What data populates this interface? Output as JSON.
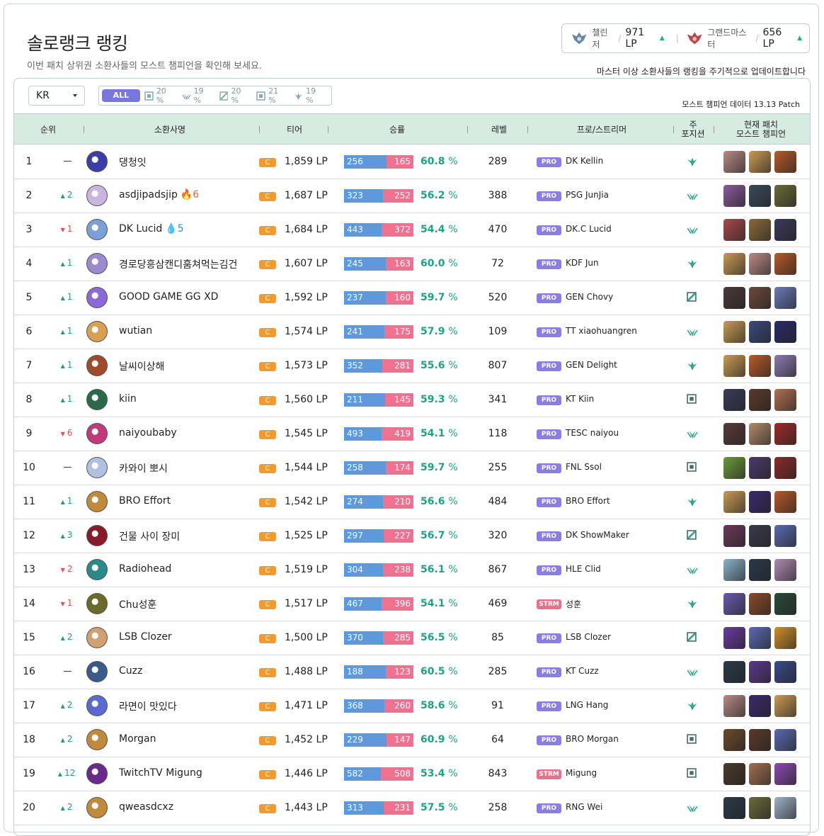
{
  "header": {
    "title": "솔로랭크 랭킹",
    "subtitle": "이번 패치 상위권 소환사들의 모스트 챔피언을 확인해 보세요.",
    "update_note": "마스터 이상 소환사들의 랭킹을 주기적으로 업데이트합니다"
  },
  "cutoffs": [
    {
      "tier": "챌린저",
      "lp": "971 LP",
      "emblem": "challenger-emblem-icon",
      "color": "#6a86a0"
    },
    {
      "tier": "그랜드마스터",
      "lp": "656 LP",
      "emblem": "grandmaster-emblem-icon",
      "color": "#b84a4a"
    }
  ],
  "filters": {
    "region": "KR",
    "all_label": "ALL",
    "positions": [
      {
        "icon": "top-icon",
        "pct": "20 %"
      },
      {
        "icon": "jungle-icon",
        "pct": "19 %"
      },
      {
        "icon": "mid-icon",
        "pct": "20 %"
      },
      {
        "icon": "bottom-icon",
        "pct": "21 %"
      },
      {
        "icon": "support-icon",
        "pct": "19 %"
      }
    ],
    "patch_note": "모스트 챔피언 데이터 13.13 Patch"
  },
  "columns": {
    "rank": "순위",
    "summoner": "소환사명",
    "tier": "티어",
    "winloss": "승률",
    "level": "레벨",
    "pro": "프로/스트리머",
    "position": "주\n포지션",
    "champions": "현재 패치\n모스트 챔피언"
  },
  "tier_letter": "C",
  "rows": [
    {
      "rank": "1",
      "change": "—",
      "dir": "none",
      "name": "댕청잇",
      "streak": "",
      "streak_type": "",
      "lp": "1,859 LP",
      "wins": "256",
      "losses": "165",
      "winrate": "60.8",
      "level": "289",
      "badge": "PRO",
      "pro": "DK Kellin",
      "pos": "support",
      "avatar": "#3b3ea8",
      "champs": [
        "#b88a86",
        "#c99a55",
        "#b65a2a"
      ]
    },
    {
      "rank": "2",
      "change": "2",
      "dir": "up",
      "name": "asdjipadsjip",
      "streak": "6",
      "streak_type": "fire",
      "lp": "1,687 LP",
      "wins": "323",
      "losses": "252",
      "winrate": "56.2",
      "level": "388",
      "badge": "PRO",
      "pro": "PSG JunJia",
      "pos": "jungle",
      "avatar": "#c9b6e0",
      "champs": [
        "#8a5a9a",
        "#3a4a5a",
        "#6a6a3a"
      ]
    },
    {
      "rank": "3",
      "change": "1",
      "dir": "down",
      "name": "DK Lucid",
      "streak": "5",
      "streak_type": "water",
      "lp": "1,684 LP",
      "wins": "443",
      "losses": "372",
      "winrate": "54.4",
      "level": "470",
      "badge": "PRO",
      "pro": "DK.C Lucid",
      "pos": "jungle",
      "avatar": "#7aa0d8",
      "champs": [
        "#a84a4a",
        "#8a6a3a",
        "#3a3a5a"
      ]
    },
    {
      "rank": "4",
      "change": "1",
      "dir": "up",
      "name": "경로당흥삼캔디훔쳐먹는김건",
      "streak": "",
      "streak_type": "",
      "lp": "1,607 LP",
      "wins": "245",
      "losses": "163",
      "winrate": "60.0",
      "level": "72",
      "badge": "PRO",
      "pro": "KDF Jun",
      "pos": "support",
      "avatar": "#9a8ad0",
      "champs": [
        "#c99a55",
        "#b88a86",
        "#b65a2a"
      ]
    },
    {
      "rank": "5",
      "change": "1",
      "dir": "up",
      "name": "GOOD GAME GG XD",
      "streak": "",
      "streak_type": "",
      "lp": "1,592 LP",
      "wins": "237",
      "losses": "160",
      "winrate": "59.7",
      "level": "520",
      "badge": "PRO",
      "pro": "GEN Chovy",
      "pos": "mid",
      "avatar": "#8a6ad8",
      "champs": [
        "#4a3a3a",
        "#6a4a3a",
        "#6a7ab8"
      ]
    },
    {
      "rank": "6",
      "change": "1",
      "dir": "up",
      "name": "wutian",
      "streak": "",
      "streak_type": "",
      "lp": "1,574 LP",
      "wins": "241",
      "losses": "175",
      "winrate": "57.9",
      "level": "109",
      "badge": "PRO",
      "pro": "TT xiaohuangren",
      "pos": "jungle",
      "avatar": "#d8a050",
      "champs": [
        "#c99a55",
        "#3a4a7a",
        "#2a2a6a"
      ]
    },
    {
      "rank": "7",
      "change": "1",
      "dir": "up",
      "name": "날씨이상해",
      "streak": "",
      "streak_type": "",
      "lp": "1,573 LP",
      "wins": "352",
      "losses": "281",
      "winrate": "55.6",
      "level": "807",
      "badge": "PRO",
      "pro": "GEN Delight",
      "pos": "support",
      "avatar": "#a04a2a",
      "champs": [
        "#c99a55",
        "#b65a2a",
        "#8a7ab0"
      ]
    },
    {
      "rank": "8",
      "change": "1",
      "dir": "up",
      "name": "kiin",
      "streak": "",
      "streak_type": "",
      "lp": "1,560 LP",
      "wins": "211",
      "losses": "145",
      "winrate": "59.3",
      "level": "341",
      "badge": "PRO",
      "pro": "KT Kiin",
      "pos": "top",
      "avatar": "#2a6a4a",
      "champs": [
        "#3a3a5a",
        "#5a3a2a",
        "#b07050"
      ]
    },
    {
      "rank": "9",
      "change": "6",
      "dir": "down",
      "name": "naiyoubaby",
      "streak": "",
      "streak_type": "",
      "lp": "1,545 LP",
      "wins": "493",
      "losses": "419",
      "winrate": "54.1",
      "level": "118",
      "badge": "PRO",
      "pro": "TESC naiyou",
      "pos": "jungle",
      "avatar": "#c03a7a",
      "champs": [
        "#5a3a3a",
        "#b08a6a",
        "#a02a2a"
      ]
    },
    {
      "rank": "10",
      "change": "—",
      "dir": "none",
      "name": "카와이 뽀시",
      "streak": "",
      "streak_type": "",
      "lp": "1,544 LP",
      "wins": "258",
      "losses": "174",
      "winrate": "59.7",
      "level": "255",
      "badge": "PRO",
      "pro": "FNL Ssol",
      "pos": "top",
      "avatar": "#b0c0e0",
      "champs": [
        "#6a9a3a",
        "#4a3a6a",
        "#8a2a2a"
      ]
    },
    {
      "rank": "11",
      "change": "1",
      "dir": "up",
      "name": "BRO Effort",
      "streak": "",
      "streak_type": "",
      "lp": "1,542 LP",
      "wins": "274",
      "losses": "210",
      "winrate": "56.6",
      "level": "484",
      "badge": "PRO",
      "pro": "BRO Effort",
      "pos": "support",
      "avatar": "#c08a3a",
      "champs": [
        "#c99a55",
        "#3a2a6a",
        "#b65a2a"
      ]
    },
    {
      "rank": "12",
      "change": "3",
      "dir": "up",
      "name": "건물 사이 장미",
      "streak": "",
      "streak_type": "",
      "lp": "1,525 LP",
      "wins": "297",
      "losses": "227",
      "winrate": "56.7",
      "level": "320",
      "badge": "PRO",
      "pro": "DK ShowMaker",
      "pos": "mid",
      "avatar": "#8a1a2a",
      "champs": [
        "#6a3a5a",
        "#3a3a4a",
        "#5a6ab0"
      ]
    },
    {
      "rank": "13",
      "change": "2",
      "dir": "down",
      "name": "Radiohead",
      "streak": "",
      "streak_type": "",
      "lp": "1,519 LP",
      "wins": "304",
      "losses": "238",
      "winrate": "56.1",
      "level": "867",
      "badge": "PRO",
      "pro": "HLE Clid",
      "pos": "jungle",
      "avatar": "#2a8a8a",
      "champs": [
        "#8ab0c8",
        "#2a3a4a",
        "#b08ab0"
      ]
    },
    {
      "rank": "14",
      "change": "1",
      "dir": "down",
      "name": "Chu성훈",
      "streak": "",
      "streak_type": "",
      "lp": "1,517 LP",
      "wins": "467",
      "losses": "396",
      "winrate": "54.1",
      "level": "469",
      "badge": "STRM",
      "pro": "성훈",
      "pos": "support",
      "avatar": "#6a6a2a",
      "champs": [
        "#6a5ab0",
        "#8a4a2a",
        "#2a4a3a"
      ]
    },
    {
      "rank": "15",
      "change": "2",
      "dir": "up",
      "name": "LSB Clozer",
      "streak": "",
      "streak_type": "",
      "lp": "1,500 LP",
      "wins": "370",
      "losses": "285",
      "winrate": "56.5",
      "level": "85",
      "badge": "PRO",
      "pro": "LSB Clozer",
      "pos": "mid",
      "avatar": "#d0a070",
      "champs": [
        "#6a3aa0",
        "#5a6ab0",
        "#d0902a"
      ]
    },
    {
      "rank": "16",
      "change": "—",
      "dir": "none",
      "name": "Cuzz",
      "streak": "",
      "streak_type": "",
      "lp": "1,488 LP",
      "wins": "188",
      "losses": "123",
      "winrate": "60.5",
      "level": "285",
      "badge": "PRO",
      "pro": "KT Cuzz",
      "pos": "jungle",
      "avatar": "#3a5a8a",
      "champs": [
        "#2a3a4a",
        "#5a3a8a",
        "#3a4a8a"
      ]
    },
    {
      "rank": "17",
      "change": "2",
      "dir": "up",
      "name": "라면이 맛있다",
      "streak": "",
      "streak_type": "",
      "lp": "1,471 LP",
      "wins": "368",
      "losses": "260",
      "winrate": "58.6",
      "level": "91",
      "badge": "PRO",
      "pro": "LNG Hang",
      "pos": "support",
      "avatar": "#5a6ad0",
      "champs": [
        "#b88a86",
        "#3a2a6a",
        "#c99a55"
      ]
    },
    {
      "rank": "18",
      "change": "2",
      "dir": "up",
      "name": "Morgan",
      "streak": "",
      "streak_type": "",
      "lp": "1,452 LP",
      "wins": "229",
      "losses": "147",
      "winrate": "60.9",
      "level": "64",
      "badge": "PRO",
      "pro": "BRO Morgan",
      "pos": "top",
      "avatar": "#c08a3a",
      "champs": [
        "#6a4a2a",
        "#5a3a2a",
        "#5a6ab0"
      ]
    },
    {
      "rank": "19",
      "change": "12",
      "dir": "up",
      "name": "TwitchTV Migung",
      "streak": "",
      "streak_type": "",
      "lp": "1,446 LP",
      "wins": "582",
      "losses": "508",
      "winrate": "53.4",
      "level": "843",
      "badge": "STRM",
      "pro": "Migung",
      "pos": "top",
      "avatar": "#6a2a8a",
      "champs": [
        "#4a3a2a",
        "#a07050",
        "#8a4ab0"
      ]
    },
    {
      "rank": "20",
      "change": "2",
      "dir": "up",
      "name": "qweasdcxz",
      "streak": "",
      "streak_type": "",
      "lp": "1,443 LP",
      "wins": "313",
      "losses": "231",
      "winrate": "57.5",
      "level": "258",
      "badge": "PRO",
      "pro": "RNG Wei",
      "pos": "jungle",
      "avatar": "#c08a3a",
      "champs": [
        "#2a3a4a",
        "#6a6a3a",
        "#a0b0c8"
      ]
    }
  ]
}
